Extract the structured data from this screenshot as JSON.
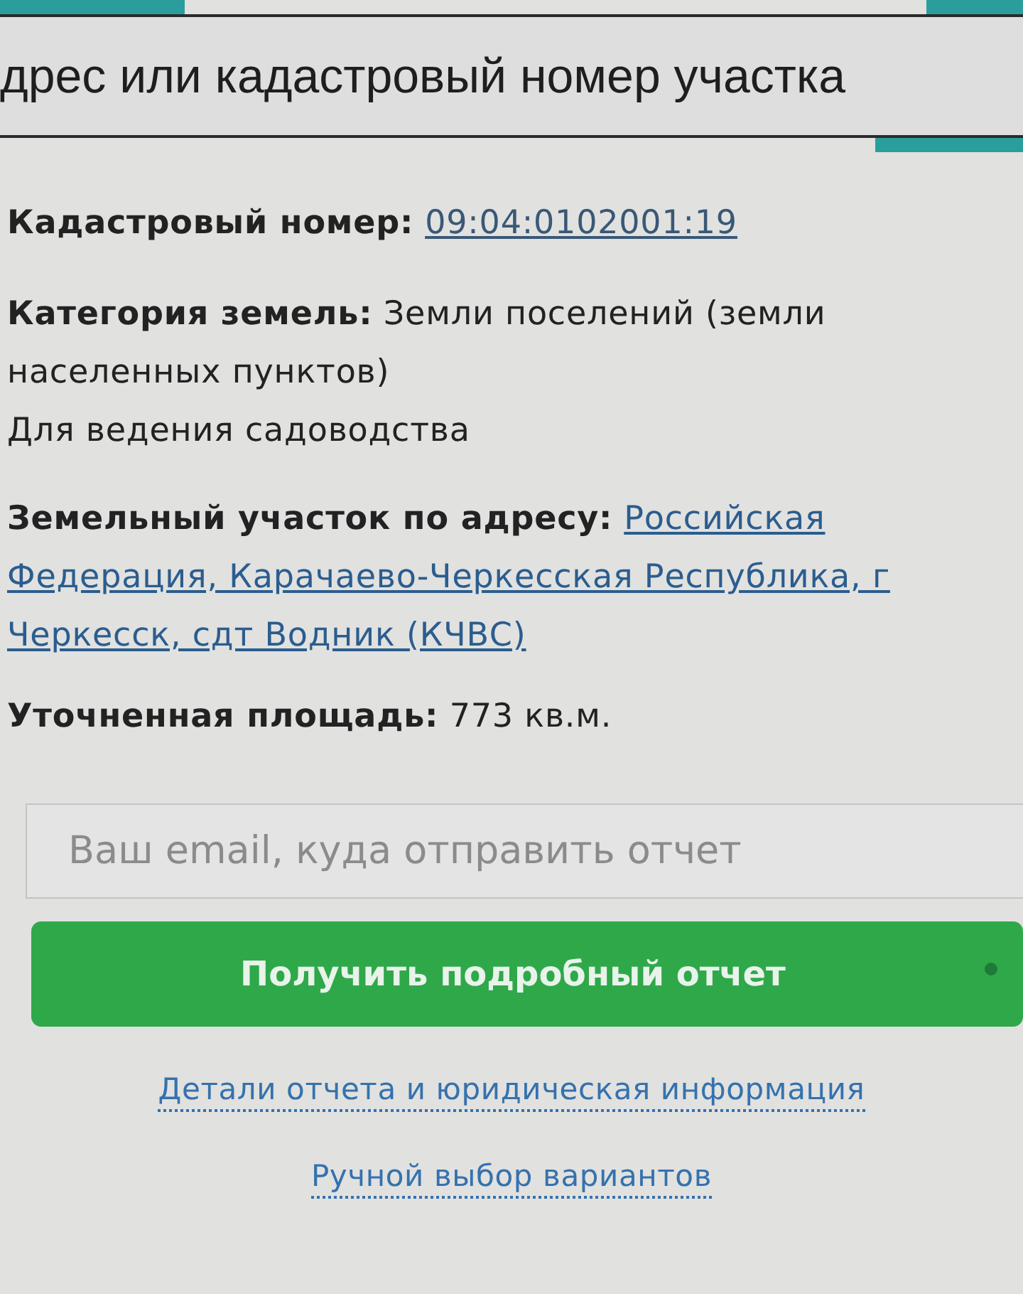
{
  "header": {
    "title": "дрес или кадастровый номер участка"
  },
  "details": {
    "cadastral_number": {
      "label": "Кадастровый номер:",
      "value": "09:04:0102001:19"
    },
    "land_category": "**Категория земель:** Земли поселений (земли населенных пунктов)",
    "permitted_use": "Для ведения садоводства",
    "address": {
      "label": "Земельный участок по адресу:",
      "value": "Российская Федерация, Карачаево-Черкесская Республика, г Черкесск, сдт Водник (КЧВС)"
    },
    "area": "**Уточненная площадь:** 773 кв.м."
  },
  "email_field": {
    "placeholder": "Ваш email, куда отправить отчет"
  },
  "submit_button": {
    "label": "Получить подробный отчет"
  },
  "links": [
    "Детали отчета и юридическая информация",
    "Ручной выбор вариантов"
  ]
}
